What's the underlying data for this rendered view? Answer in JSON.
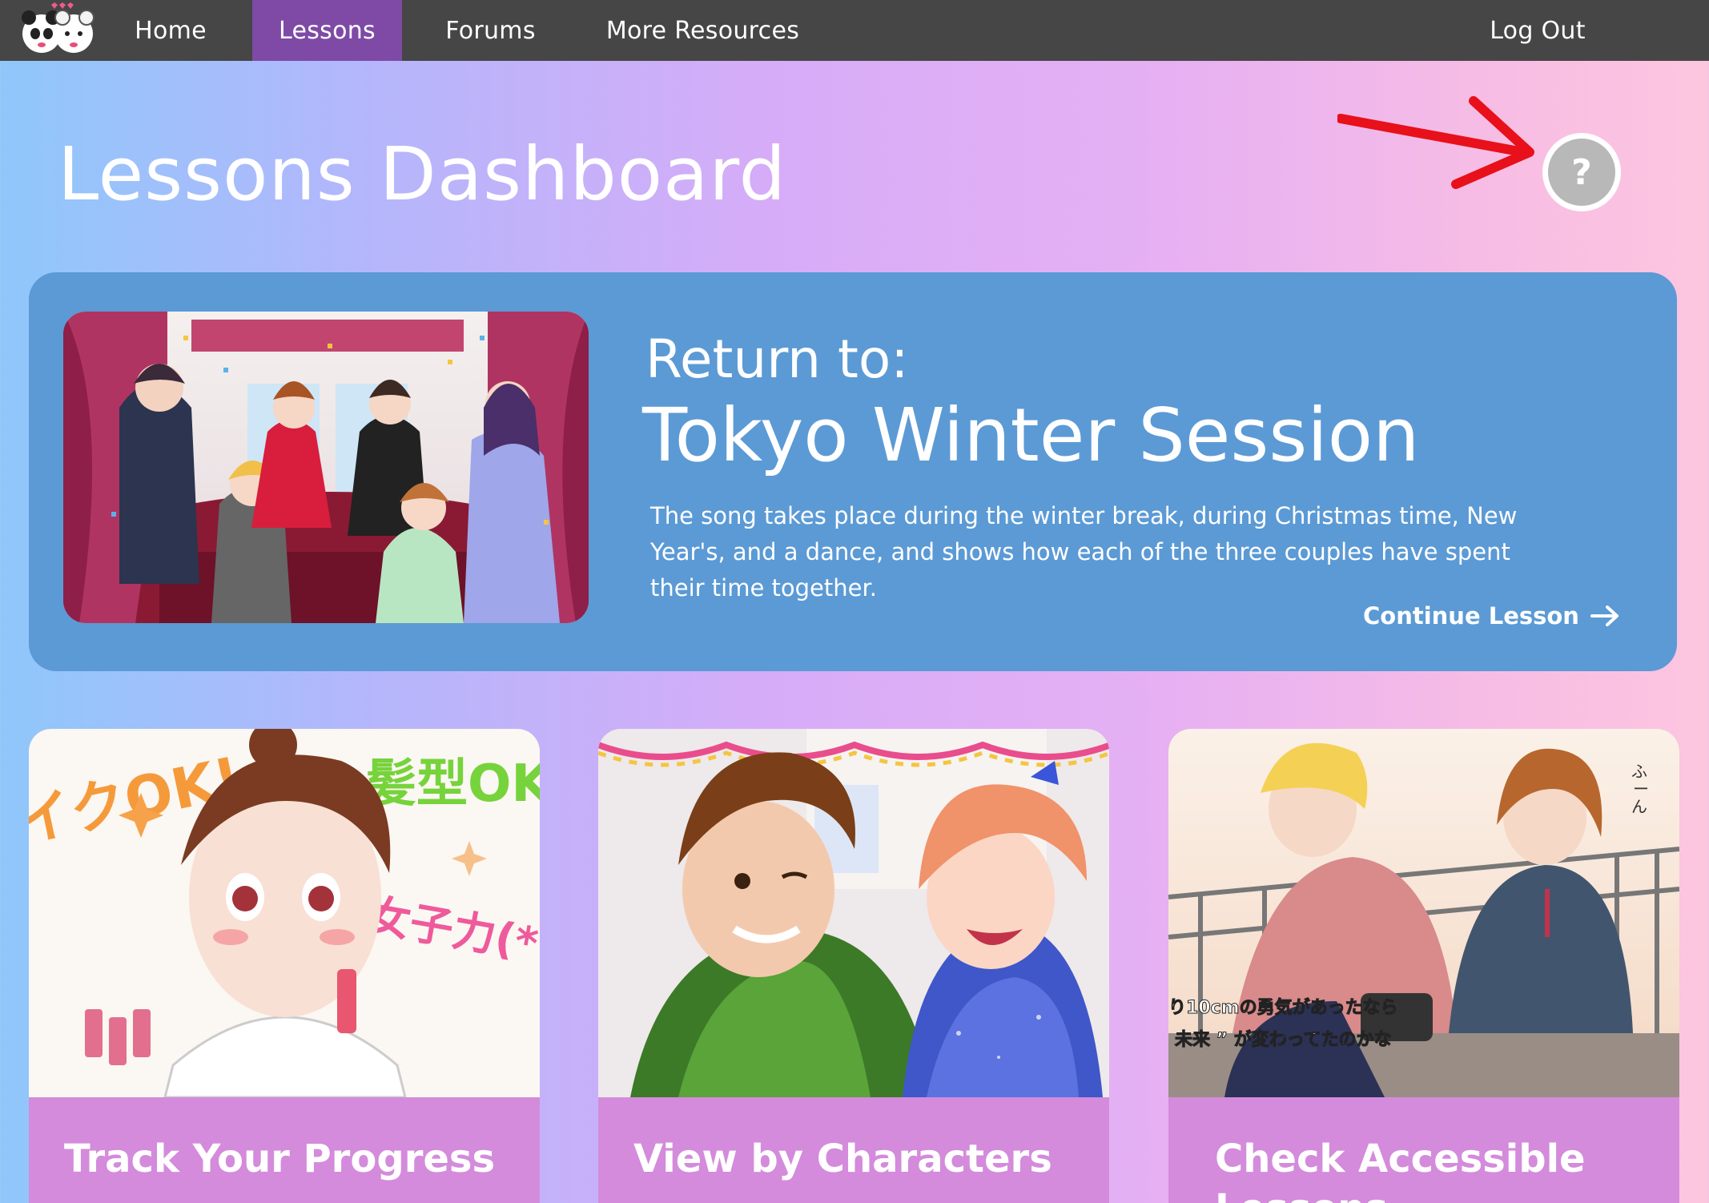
{
  "nav": {
    "items": [
      {
        "label": "Home",
        "active": false
      },
      {
        "label": "Lessons",
        "active": true
      },
      {
        "label": "Forums",
        "active": false
      },
      {
        "label": "More Resources",
        "active": false
      }
    ],
    "logout_label": "Log Out",
    "logo_icon": "panda-mascots-logo"
  },
  "page": {
    "title": "Lessons Dashboard",
    "help_label": "?",
    "annotation_icon": "red-arrow-annotation"
  },
  "hero": {
    "kicker": "Return to:",
    "title": "Tokyo Winter Session",
    "description": "The song takes place during the winter break, during Christmas time, New Year's, and a dance, and shows how each of the three couples have spent their time together.",
    "cta_label": "Continue Lesson",
    "cta_icon": "arrow-right-icon"
  },
  "cards": [
    {
      "label": "Track Your Progress"
    },
    {
      "label": "View by Characters"
    },
    {
      "label": "Check Accessible Lessons"
    }
  ],
  "colors": {
    "nav_bg": "#464646",
    "nav_active": "#7e4aa6",
    "hero_bg": "#5b9ad5",
    "card_label_bg": "#d48bdc",
    "help_bg": "#b8b8b8",
    "annotation": "#e8101a"
  }
}
